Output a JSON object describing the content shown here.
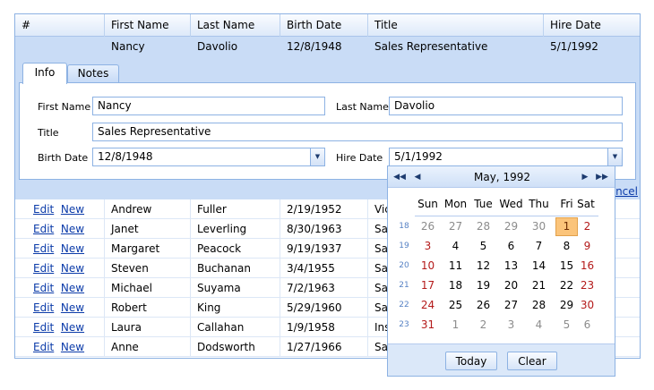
{
  "grid": {
    "columns": [
      "#",
      "First Name",
      "Last Name",
      "Birth Date",
      "Title",
      "Hire Date"
    ],
    "edit_row": {
      "first_name": "Nancy",
      "last_name": "Davolio",
      "birth_date": "12/8/1948",
      "title": "Sales Representative",
      "hire_date": "5/1/1992"
    },
    "rows": [
      {
        "first": "Andrew",
        "last": "Fuller",
        "birth": "2/19/1952",
        "title": "Vic"
      },
      {
        "first": "Janet",
        "last": "Leverling",
        "birth": "8/30/1963",
        "title": "Sal"
      },
      {
        "first": "Margaret",
        "last": "Peacock",
        "birth": "9/19/1937",
        "title": "Sal"
      },
      {
        "first": "Steven",
        "last": "Buchanan",
        "birth": "3/4/1955",
        "title": "Sal"
      },
      {
        "first": "Michael",
        "last": "Suyama",
        "birth": "7/2/1963",
        "title": "Sal"
      },
      {
        "first": "Robert",
        "last": "King",
        "birth": "5/29/1960",
        "title": "Sal"
      },
      {
        "first": "Laura",
        "last": "Callahan",
        "birth": "1/9/1958",
        "title": "Ins"
      },
      {
        "first": "Anne",
        "last": "Dodsworth",
        "birth": "1/27/1966",
        "title": "Sal"
      }
    ],
    "edit_label": "Edit",
    "new_label": "New",
    "cancel_label": "ancel"
  },
  "form": {
    "tabs": [
      "Info",
      "Notes"
    ],
    "first_name_label": "First Name",
    "first_name_value": "Nancy",
    "last_name_label": "Last Name",
    "last_name_value": "Davolio",
    "title_label": "Title",
    "title_value": "Sales Representative",
    "birth_date_label": "Birth Date",
    "birth_date_value": "12/8/1948",
    "hire_date_label": "Hire Date",
    "hire_date_value": "5/1/1992"
  },
  "calendar": {
    "title": "May, 1992",
    "nav": {
      "prev_year": "◀◀",
      "prev_month": "◀",
      "next_month": "▶",
      "next_year": "▶▶"
    },
    "weekdays": [
      "Sun",
      "Mon",
      "Tue",
      "Wed",
      "Thu",
      "Fri",
      "Sat"
    ],
    "week_numbers": [
      "18",
      "19",
      "20",
      "21",
      "22",
      "23"
    ],
    "weeks": [
      [
        "26",
        "27",
        "28",
        "29",
        "30",
        "1",
        "2"
      ],
      [
        "3",
        "4",
        "5",
        "6",
        "7",
        "8",
        "9"
      ],
      [
        "10",
        "11",
        "12",
        "13",
        "14",
        "15",
        "16"
      ],
      [
        "17",
        "18",
        "19",
        "20",
        "21",
        "22",
        "23"
      ],
      [
        "24",
        "25",
        "26",
        "27",
        "28",
        "29",
        "30"
      ],
      [
        "31",
        "1",
        "2",
        "3",
        "4",
        "5",
        "6"
      ]
    ],
    "selected_day": "1",
    "today_label": "Today",
    "clear_label": "Clear",
    "colors": {
      "selected": "#fbc47a",
      "weekend": "#b41a1a",
      "other_month": "#8c8c8c"
    }
  }
}
